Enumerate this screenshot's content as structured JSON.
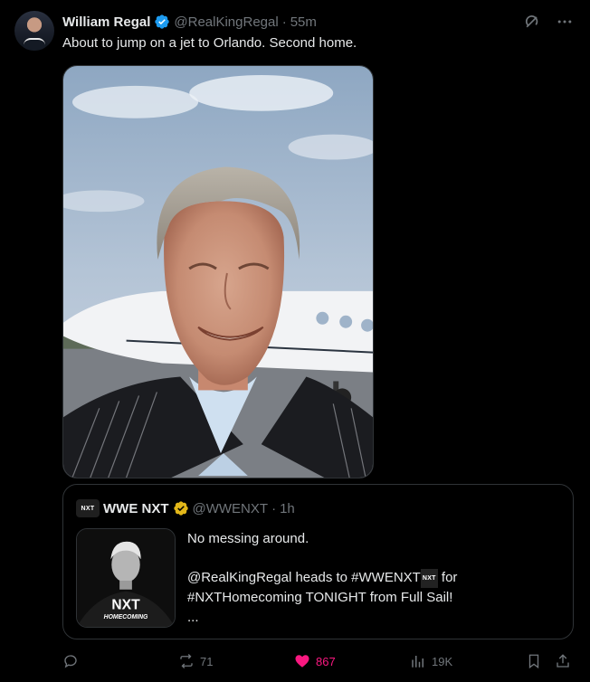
{
  "post": {
    "author_name": "William Regal",
    "author_handle": "@RealKingRegal",
    "separator": "·",
    "time": "55m",
    "text": "About to jump on a jet to Orlando. Second home.",
    "photo_desc_icon": "photo-icon"
  },
  "quote": {
    "logo_text": "NXT",
    "author_name": "WWE NXT",
    "author_handle": "@WWENXT",
    "separator": "·",
    "time": "1h",
    "line1": "No messing around.",
    "line2_a": "@RealKingRegal heads to #WWENXT",
    "line2_mini": "NXT",
    "line2_b": " for",
    "line3": "#NXTHomecoming TONIGHT from Full Sail!",
    "line4": "...",
    "thumb_logo": "NXT",
    "thumb_sub": "HOMECOMING"
  },
  "actions": {
    "replies": "",
    "reposts": "71",
    "likes": "867",
    "views": "19K"
  },
  "colors": {
    "background": "#000000",
    "verified_blue": "#1d9bf0",
    "verified_gold": "#e2b719",
    "like_pink": "#f91880",
    "muted": "#71767b",
    "border": "#2f3336"
  }
}
